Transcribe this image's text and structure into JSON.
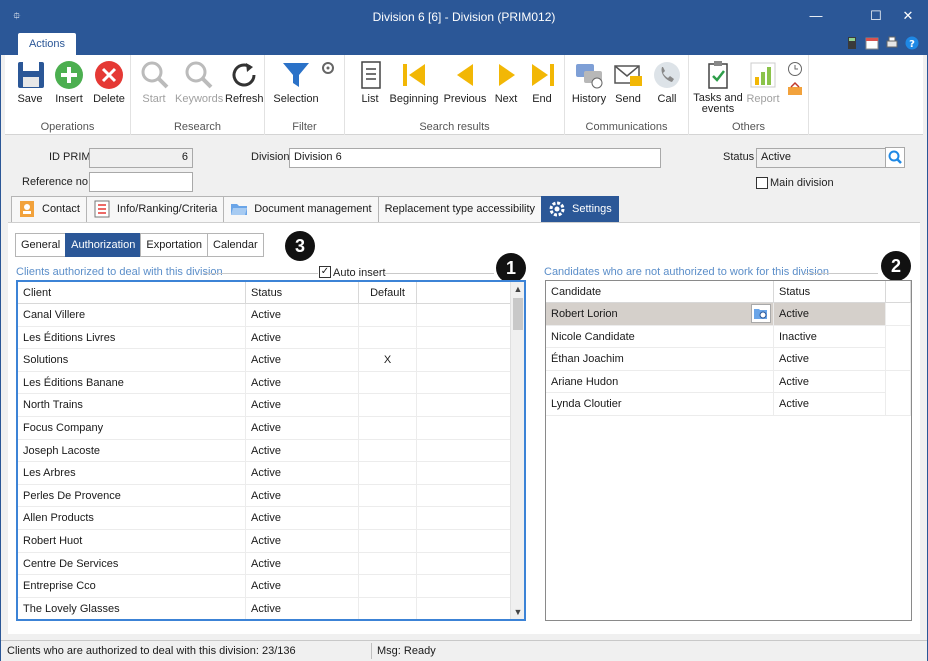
{
  "window": {
    "title": "Division 6 [6] - Division (PRIM012)",
    "sysmenu_glyph": "⯐",
    "minimize_glyph": "—",
    "maximize_glyph": "☐",
    "close_glyph": "✕"
  },
  "ribbon": {
    "tab": "Actions",
    "groups": {
      "operations": {
        "label": "Operations",
        "save": "Save",
        "insert": "Insert",
        "delete": "Delete"
      },
      "research": {
        "label": "Research",
        "start": "Start",
        "keywords": "Keywords",
        "refresh": "Refresh"
      },
      "filter": {
        "label": "Filter",
        "selection": "Selection"
      },
      "search_results": {
        "label": "Search results",
        "list": "List",
        "beginning": "Beginning",
        "previous": "Previous",
        "next": "Next",
        "end": "End"
      },
      "communications": {
        "label": "Communications",
        "history": "History",
        "send": "Send",
        "call": "Call"
      },
      "others": {
        "label": "Others",
        "tasks_line1": "Tasks and",
        "tasks_line2": "events",
        "report": "Report"
      }
    }
  },
  "form": {
    "id_prim_label": "ID PRIM",
    "id_prim_value": "6",
    "division_label": "Division",
    "division_value": "Division 6",
    "status_label": "Status",
    "status_value": "Active",
    "reference_label": "Reference no.",
    "reference_value": "",
    "main_division_label": "Main division"
  },
  "main_tabs": [
    "Contact",
    "Info/Ranking/Criteria",
    "Document management",
    "Replacement type accessibility",
    "Settings"
  ],
  "sub_tabs": [
    "General",
    "Authorization",
    "Exportation",
    "Calendar"
  ],
  "callouts": [
    "1",
    "2",
    "3"
  ],
  "clients_section": {
    "title": "Clients authorized to deal with this division",
    "auto_insert_label": "Auto insert",
    "auto_insert_mark": "✓",
    "columns": [
      "Client",
      "Status",
      "Default"
    ],
    "rows": [
      {
        "client": "Canal Villere",
        "status": "Active",
        "default": ""
      },
      {
        "client": "Les Éditions Livres",
        "status": "Active",
        "default": ""
      },
      {
        "client": "Solutions",
        "status": "Active",
        "default": "X"
      },
      {
        "client": "Les Éditions Banane",
        "status": "Active",
        "default": ""
      },
      {
        "client": "North Trains",
        "status": "Active",
        "default": ""
      },
      {
        "client": "Focus Company",
        "status": "Active",
        "default": ""
      },
      {
        "client": "Joseph Lacoste",
        "status": "Active",
        "default": ""
      },
      {
        "client": "Les Arbres",
        "status": "Active",
        "default": ""
      },
      {
        "client": "Perles De Provence",
        "status": "Active",
        "default": ""
      },
      {
        "client": "Allen Products",
        "status": "Active",
        "default": ""
      },
      {
        "client": "Robert Huot",
        "status": "Active",
        "default": ""
      },
      {
        "client": "Centre De Services",
        "status": "Active",
        "default": ""
      },
      {
        "client": "Entreprise Cco",
        "status": "Active",
        "default": ""
      },
      {
        "client": "The Lovely Glasses",
        "status": "Active",
        "default": ""
      }
    ]
  },
  "candidates_section": {
    "title": "Candidates who are not authorized to work for this division",
    "columns": [
      "Candidate",
      "Status"
    ],
    "rows": [
      {
        "candidate": "Robert Lorion",
        "status": "Active",
        "selected": true
      },
      {
        "candidate": "Nicole Candidate",
        "status": "Inactive",
        "selected": false
      },
      {
        "candidate": "Éthan Joachim",
        "status": "Active",
        "selected": false
      },
      {
        "candidate": "Ariane Hudon",
        "status": "Active",
        "selected": false
      },
      {
        "candidate": "Lynda Cloutier",
        "status": "Active",
        "selected": false
      }
    ]
  },
  "statusbar": {
    "left": "Clients who are authorized to deal with this division: 23/136",
    "right": "Msg: Ready"
  },
  "colors": {
    "accent": "#2b5797",
    "section_title": "#5b8ec9",
    "selected_row": "#d5d0cb"
  }
}
